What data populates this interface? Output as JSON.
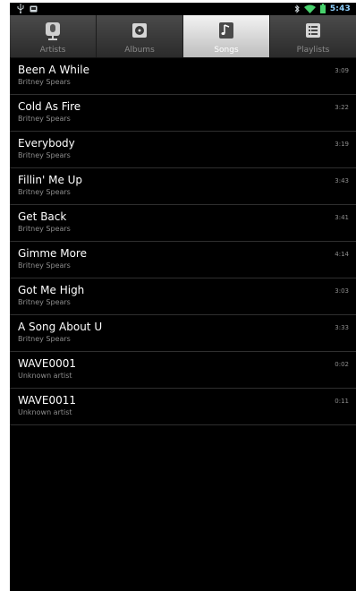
{
  "status_bar": {
    "time": "5:43",
    "icons": [
      "usb-icon",
      "notification-icon",
      "bluetooth-icon",
      "wifi-icon",
      "battery-icon"
    ]
  },
  "tabs": [
    {
      "label": "Artists",
      "icon": "microphone-icon",
      "selected": false
    },
    {
      "label": "Albums",
      "icon": "album-icon",
      "selected": false
    },
    {
      "label": "Songs",
      "icon": "music-note-icon",
      "selected": true
    },
    {
      "label": "Playlists",
      "icon": "playlist-icon",
      "selected": false
    }
  ],
  "songs": [
    {
      "title": "Been A While",
      "artist": "Britney Spears",
      "duration": "3:09"
    },
    {
      "title": "Cold As Fire",
      "artist": "Britney Spears",
      "duration": "3:22"
    },
    {
      "title": "Everybody",
      "artist": "Britney Spears",
      "duration": "3:19"
    },
    {
      "title": "Fillin' Me Up",
      "artist": "Britney Spears",
      "duration": "3:43"
    },
    {
      "title": "Get Back",
      "artist": "Britney Spears",
      "duration": "3:41"
    },
    {
      "title": "Gimme More",
      "artist": "Britney Spears",
      "duration": "4:14"
    },
    {
      "title": "Got Me High",
      "artist": "Britney Spears",
      "duration": "3:03"
    },
    {
      "title": "A Song About U",
      "artist": "Britney Spears",
      "duration": "3:33"
    },
    {
      "title": "WAVE0001",
      "artist": "Unknown artist",
      "duration": "0:02"
    },
    {
      "title": "WAVE0011",
      "artist": "Unknown artist",
      "duration": "0:11"
    }
  ],
  "colors": {
    "background": "#000000",
    "title": "#ffffff",
    "secondary": "#8d8d8d",
    "clock": "#8fd1ff",
    "wifi": "#47d16c"
  }
}
